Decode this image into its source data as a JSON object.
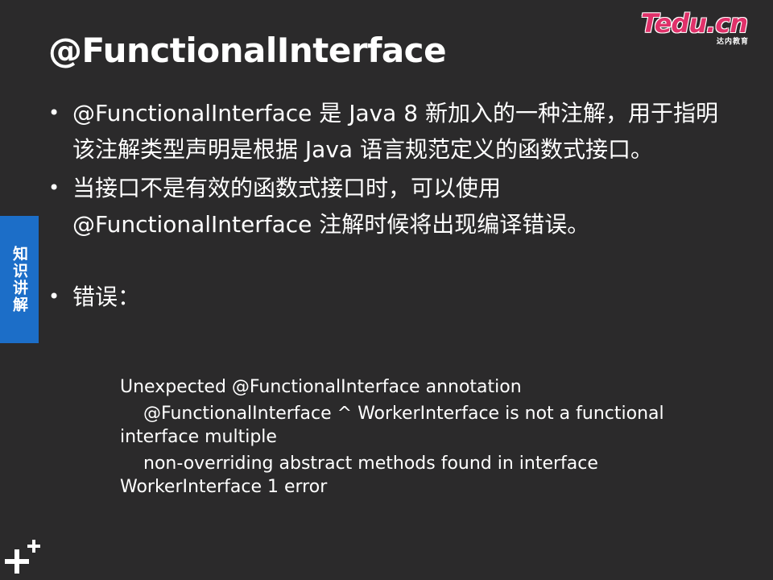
{
  "slide": {
    "title": "@FunctionalInterface",
    "logo": {
      "main": "Tedu.cn",
      "sub": "达内教育"
    },
    "side_tab": "知识讲解",
    "bullets": [
      {
        "text": "@FunctionalInterface 是 Java 8 新加入的一种注解，用于指明该注解类型声明是根据 Java 语言规范定义的函数式接口。"
      },
      {
        "text": "当接口不是有效的函数式接口时，可以使用 @FunctionalInterface 注解时候将出现编译错误。"
      },
      {
        "text": "错误："
      }
    ],
    "error_lines": {
      "line1": "Unexpected @FunctionalInterface annotation",
      "line2a": "@FunctionalInterface ^ WorkerInterface is not a functional",
      "line2b": "interface multiple",
      "line3a": "non-overriding abstract methods found in interface",
      "line3b": "WorkerInterface 1 error"
    },
    "colors": {
      "background": "#2b2a2b",
      "text": "#ffffff",
      "side_tab": "#1c6ec8",
      "logo": "#e0316a"
    },
    "icons": [
      "plus-plus-icon",
      "bullet-dot-icon"
    ]
  }
}
